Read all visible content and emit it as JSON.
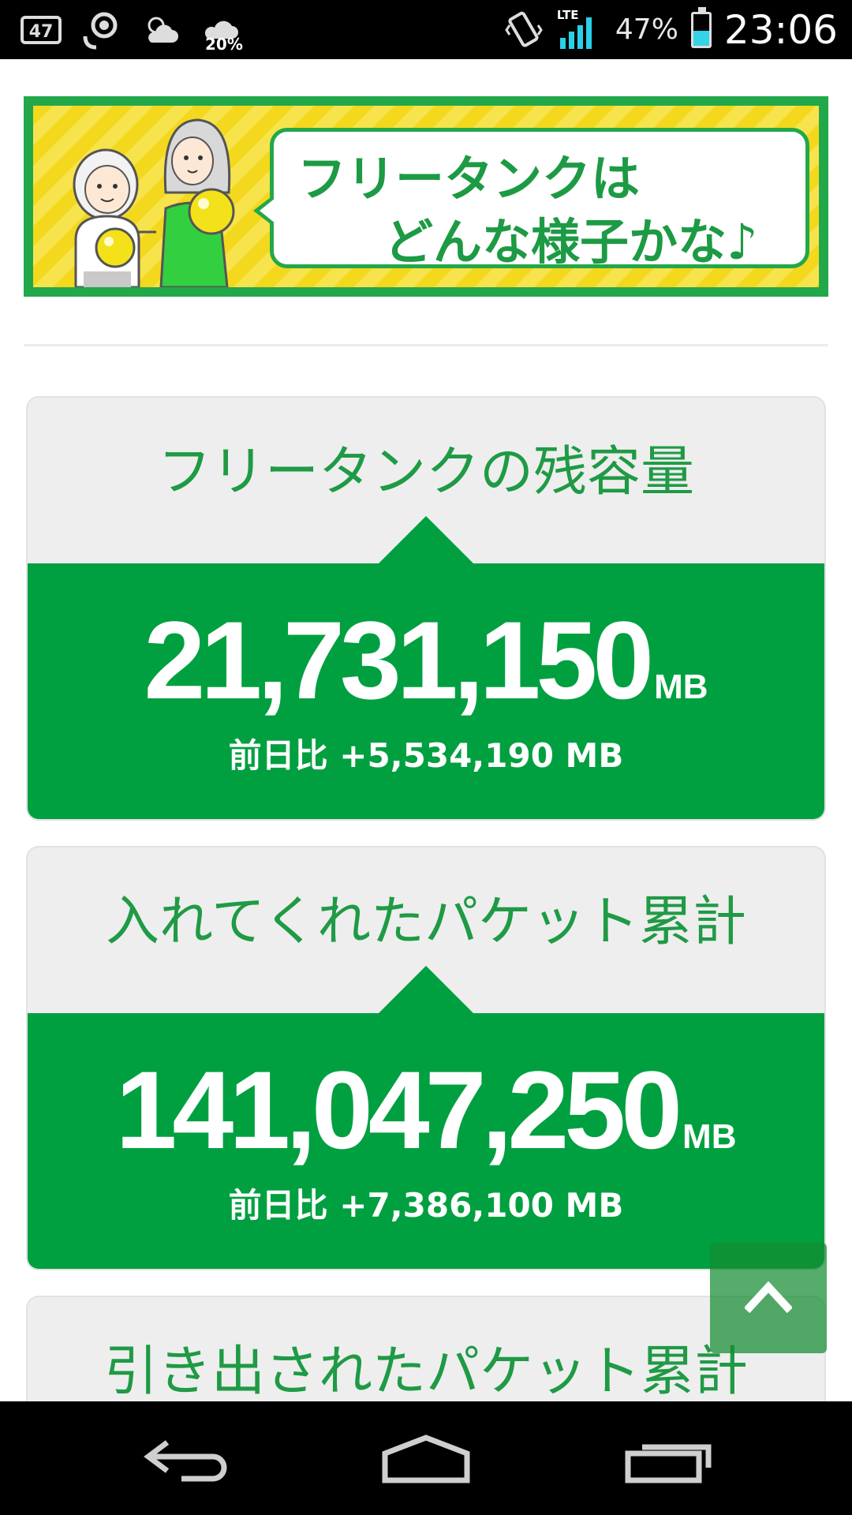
{
  "status_bar": {
    "notification_count": "47",
    "rain_chance": "20%",
    "network": "LTE",
    "battery_percent": "47%",
    "time": "23:06",
    "accent_color": "#2ad0e8"
  },
  "banner": {
    "line1": "フリータンクは",
    "line2": "どんな様子かな♪",
    "colors": {
      "frame": "#22a84a",
      "stripe_a": "#f3d81e",
      "stripe_b": "#f7e34c"
    }
  },
  "cards": [
    {
      "title": "フリータンクの残容量",
      "value": "21,731,150",
      "unit": "MB",
      "diff": "前日比 +5,534,190 MB"
    },
    {
      "title": "入れてくれたパケット累計",
      "value": "141,047,250",
      "unit": "MB",
      "diff": "前日比 +7,386,100 MB"
    },
    {
      "title": "引き出されたパケット累計"
    }
  ],
  "icons": {
    "scroll_top": "chevron-up-icon",
    "nav_back": "back-arrow-icon",
    "nav_home": "home-icon",
    "nav_recents": "recent-apps-icon"
  },
  "theme": {
    "green": "#00a040",
    "green_text": "#1f9a45",
    "card_bg": "#eeeeee"
  }
}
